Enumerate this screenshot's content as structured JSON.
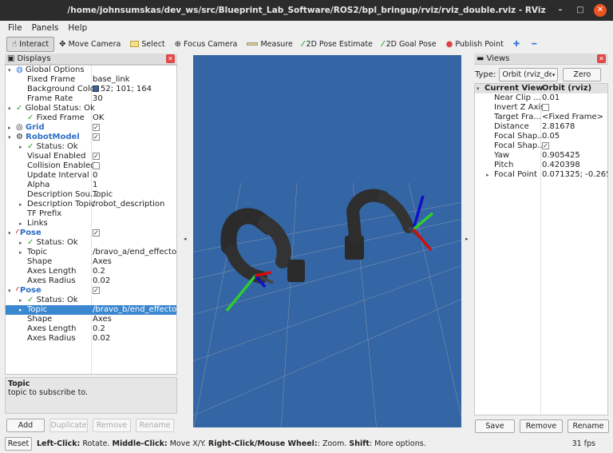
{
  "title": "/home/johnsumskas/dev_ws/src/Blueprint_Lab_Software/ROS2/bpl_bringup/rviz/rviz_double.rviz - RViz",
  "window_controls": {
    "minimize": "–",
    "maximize": "□",
    "close": "✕"
  },
  "menu": {
    "file": "File",
    "panels": "Panels",
    "help": "Help"
  },
  "toolbar": {
    "interact": "Interact",
    "move_camera": "Move Camera",
    "select": "Select",
    "focus_camera": "Focus Camera",
    "measure": "Measure",
    "pose_estimate": "2D Pose Estimate",
    "goal_pose": "2D Goal Pose",
    "publish_point": "Publish Point"
  },
  "displays": {
    "header": "Displays",
    "rows": [
      {
        "k": "Global Options",
        "v": ""
      },
      {
        "k": "Fixed Frame",
        "v": "base_link"
      },
      {
        "k": "Background Color",
        "v": "52; 101; 164"
      },
      {
        "k": "Frame Rate",
        "v": "30"
      },
      {
        "k": "Global Status: Ok",
        "v": ""
      },
      {
        "k": "Fixed Frame",
        "v": "OK"
      },
      {
        "k": "Grid",
        "v": ""
      },
      {
        "k": "RobotModel",
        "v": ""
      },
      {
        "k": "Status: Ok",
        "v": ""
      },
      {
        "k": "Visual Enabled",
        "v": ""
      },
      {
        "k": "Collision Enabled",
        "v": ""
      },
      {
        "k": "Update Interval",
        "v": "0"
      },
      {
        "k": "Alpha",
        "v": "1"
      },
      {
        "k": "Description Sou...",
        "v": "Topic"
      },
      {
        "k": "Description Topic",
        "v": "/robot_description"
      },
      {
        "k": "TF Prefix",
        "v": ""
      },
      {
        "k": "Links",
        "v": ""
      },
      {
        "k": "Pose",
        "v": ""
      },
      {
        "k": "Status: Ok",
        "v": ""
      },
      {
        "k": "Topic",
        "v": "/bravo_a/end_effecto..."
      },
      {
        "k": "Shape",
        "v": "Axes"
      },
      {
        "k": "Axes Length",
        "v": "0.2"
      },
      {
        "k": "Axes Radius",
        "v": "0.02"
      },
      {
        "k": "Pose",
        "v": ""
      },
      {
        "k": "Status: Ok",
        "v": ""
      },
      {
        "k": "Topic",
        "v": "/bravo_b/end_effecto..."
      },
      {
        "k": "Shape",
        "v": "Axes"
      },
      {
        "k": "Axes Length",
        "v": "0.2"
      },
      {
        "k": "Axes Radius",
        "v": "0.02"
      }
    ],
    "help_title": "Topic",
    "help_text": "topic to subscribe to.",
    "buttons": {
      "add": "Add",
      "duplicate": "Duplicate",
      "remove": "Remove",
      "rename": "Rename"
    }
  },
  "views": {
    "header": "Views",
    "type_label": "Type:",
    "type_value": "Orbit (rviz_defau",
    "zero": "Zero",
    "rows": [
      {
        "k": "Current View",
        "v": "Orbit (rviz)"
      },
      {
        "k": "Near Clip ...",
        "v": "0.01"
      },
      {
        "k": "Invert Z Axis",
        "v": ""
      },
      {
        "k": "Target Fra...",
        "v": "<Fixed Frame>"
      },
      {
        "k": "Distance",
        "v": "2.81678"
      },
      {
        "k": "Focal Shap...",
        "v": "0.05"
      },
      {
        "k": "Focal Shap...",
        "v": ""
      },
      {
        "k": "Yaw",
        "v": "0.905425"
      },
      {
        "k": "Pitch",
        "v": "0.420398"
      },
      {
        "k": "Focal Point",
        "v": "0.071325; -0.265..."
      }
    ],
    "buttons": {
      "save": "Save",
      "remove": "Remove",
      "rename": "Rename"
    }
  },
  "status": {
    "reset": "Reset",
    "left_click": "Left-Click:",
    "left_desc": " Rotate. ",
    "middle_click": "Middle-Click:",
    "middle_desc": " Move X/Y. ",
    "right_click": "Right-Click/Mouse Wheel:",
    "right_desc": ": Zoom. ",
    "shift": "Shift",
    "shift_desc": ": More options.",
    "fps": "31 fps"
  },
  "colors": {
    "background": "#3465a4",
    "selection": "#3b87cf",
    "accent_close": "#e95420"
  }
}
